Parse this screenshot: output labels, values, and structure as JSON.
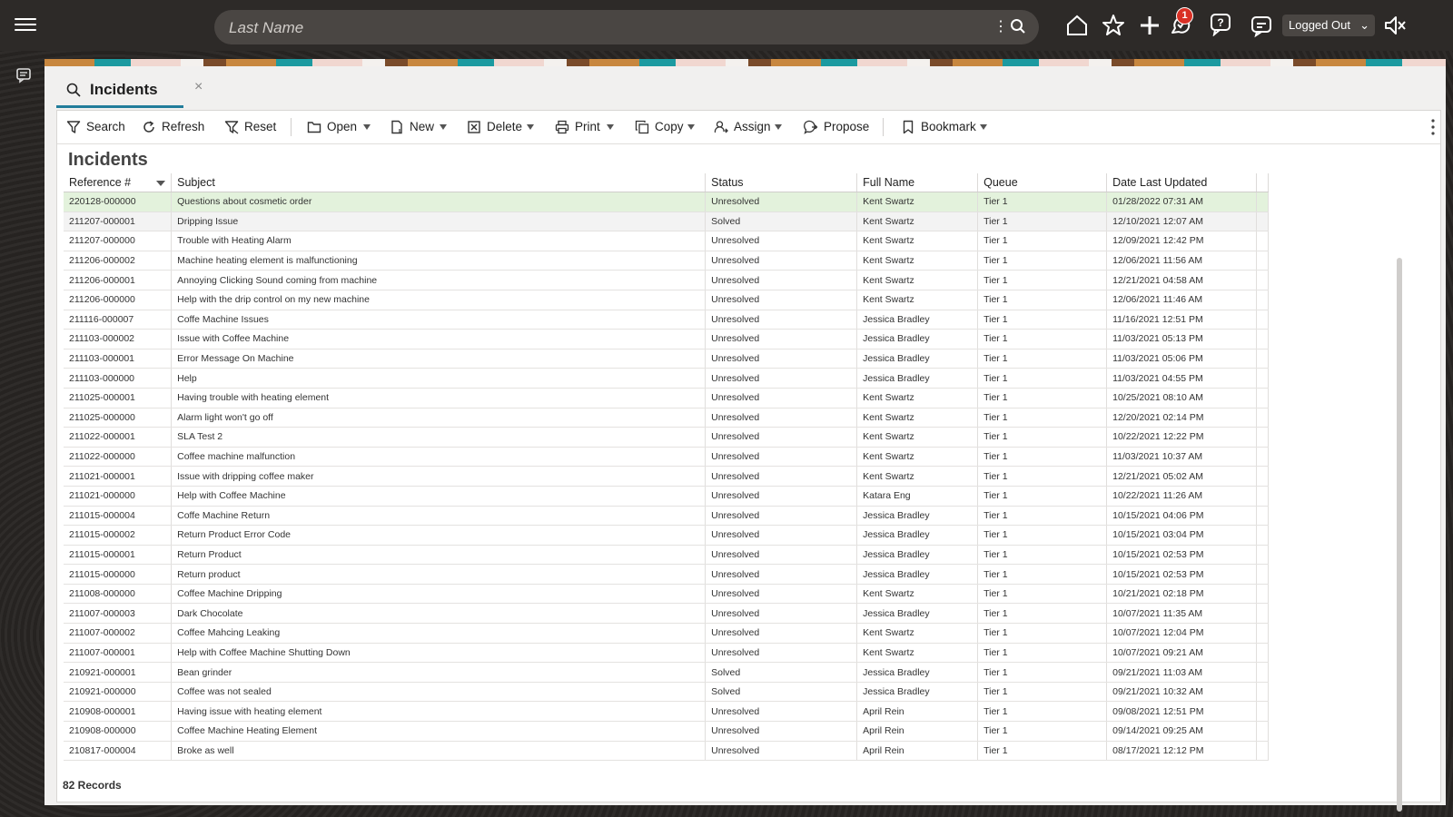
{
  "search": {
    "placeholder": "Last Name"
  },
  "header": {
    "notification_count": "1",
    "status_select": "Logged Out"
  },
  "tab": {
    "label": "Incidents",
    "close": "×"
  },
  "toolbar": {
    "search": "Search",
    "refresh": "Refresh",
    "reset": "Reset",
    "open": "Open",
    "new": "New",
    "delete": "Delete",
    "print": "Print",
    "copy": "Copy",
    "assign": "Assign",
    "propose": "Propose",
    "bookmark": "Bookmark"
  },
  "report": {
    "title": "Incidents",
    "record_count": "82 Records"
  },
  "table": {
    "columns": [
      "Reference #",
      "Subject",
      "Status",
      "Full Name",
      "Queue",
      "Date Last Updated"
    ],
    "rows": [
      [
        "220128-000000",
        "Questions about cosmetic order",
        "Unresolved",
        "Kent Swartz",
        "Tier 1",
        "01/28/2022 07:31 AM"
      ],
      [
        "211207-000001",
        "Dripping Issue",
        "Solved",
        "Kent Swartz",
        "Tier 1",
        "12/10/2021 12:07 AM"
      ],
      [
        "211207-000000",
        "Trouble with Heating Alarm",
        "Unresolved",
        "Kent Swartz",
        "Tier 1",
        "12/09/2021 12:42 PM"
      ],
      [
        "211206-000002",
        "Machine heating element is malfunctioning",
        "Unresolved",
        "Kent Swartz",
        "Tier 1",
        "12/06/2021 11:56 AM"
      ],
      [
        "211206-000001",
        "Annoying Clicking Sound coming from machine",
        "Unresolved",
        "Kent Swartz",
        "Tier 1",
        "12/21/2021 04:58 AM"
      ],
      [
        "211206-000000",
        "Help with the drip control on my new machine",
        "Unresolved",
        "Kent Swartz",
        "Tier 1",
        "12/06/2021 11:46 AM"
      ],
      [
        "211116-000007",
        "Coffe Machine Issues",
        "Unresolved",
        "Jessica Bradley",
        "Tier 1",
        "11/16/2021 12:51 PM"
      ],
      [
        "211103-000002",
        "Issue with Coffee Machine",
        "Unresolved",
        "Jessica Bradley",
        "Tier 1",
        "11/03/2021 05:13 PM"
      ],
      [
        "211103-000001",
        "Error Message On Machine",
        "Unresolved",
        "Jessica Bradley",
        "Tier 1",
        "11/03/2021 05:06 PM"
      ],
      [
        "211103-000000",
        "Help",
        "Unresolved",
        "Jessica Bradley",
        "Tier 1",
        "11/03/2021 04:55 PM"
      ],
      [
        "211025-000001",
        "Having trouble with heating element",
        "Unresolved",
        "Kent Swartz",
        "Tier 1",
        "10/25/2021 08:10 AM"
      ],
      [
        "211025-000000",
        "Alarm light won't go off",
        "Unresolved",
        "Kent Swartz",
        "Tier 1",
        "12/20/2021 02:14 PM"
      ],
      [
        "211022-000001",
        "SLA Test 2",
        "Unresolved",
        "Kent Swartz",
        "Tier 1",
        "10/22/2021 12:22 PM"
      ],
      [
        "211022-000000",
        "Coffee machine malfunction",
        "Unresolved",
        "Kent Swartz",
        "Tier 1",
        "11/03/2021 10:37 AM"
      ],
      [
        "211021-000001",
        "Issue with dripping coffee maker",
        "Unresolved",
        "Kent Swartz",
        "Tier 1",
        "12/21/2021 05:02 AM"
      ],
      [
        "211021-000000",
        "Help with Coffee Machine",
        "Unresolved",
        "Katara Eng",
        "Tier 1",
        "10/22/2021 11:26 AM"
      ],
      [
        "211015-000004",
        "Coffe Machine Return",
        "Unresolved",
        "Jessica Bradley",
        "Tier 1",
        "10/15/2021 04:06 PM"
      ],
      [
        "211015-000002",
        "Return Product Error Code",
        "Unresolved",
        "Jessica Bradley",
        "Tier 1",
        "10/15/2021 03:04 PM"
      ],
      [
        "211015-000001",
        "Return Product",
        "Unresolved",
        "Jessica Bradley",
        "Tier 1",
        "10/15/2021 02:53 PM"
      ],
      [
        "211015-000000",
        "Return product",
        "Unresolved",
        "Jessica Bradley",
        "Tier 1",
        "10/15/2021 02:53 PM"
      ],
      [
        "211008-000000",
        "Coffee Machine Dripping",
        "Unresolved",
        "Kent Swartz",
        "Tier 1",
        "10/21/2021 02:18 PM"
      ],
      [
        "211007-000003",
        "Dark Chocolate",
        "Unresolved",
        "Jessica Bradley",
        "Tier 1",
        "10/07/2021 11:35 AM"
      ],
      [
        "211007-000002",
        "Coffee Mahcing Leaking",
        "Unresolved",
        "Kent Swartz",
        "Tier 1",
        "10/07/2021 12:04 PM"
      ],
      [
        "211007-000001",
        "Help with Coffee Machine Shutting Down",
        "Unresolved",
        "Kent Swartz",
        "Tier 1",
        "10/07/2021 09:21 AM"
      ],
      [
        "210921-000001",
        "Bean grinder",
        "Solved",
        "Jessica Bradley",
        "Tier 1",
        "09/21/2021 11:03 AM"
      ],
      [
        "210921-000000",
        "Coffee was not sealed",
        "Solved",
        "Jessica Bradley",
        "Tier 1",
        "09/21/2021 10:32 AM"
      ],
      [
        "210908-000001",
        "Having issue with heating element",
        "Unresolved",
        "April Rein",
        "Tier 1",
        "09/08/2021 12:51 PM"
      ],
      [
        "210908-000000",
        "Coffee Machine Heating Element",
        "Unresolved",
        "April Rein",
        "Tier 1",
        "09/14/2021 09:25 AM"
      ],
      [
        "210817-000004",
        "Broke as well",
        "Unresolved",
        "April Rein",
        "Tier 1",
        "08/17/2021 12:12 PM"
      ]
    ]
  }
}
